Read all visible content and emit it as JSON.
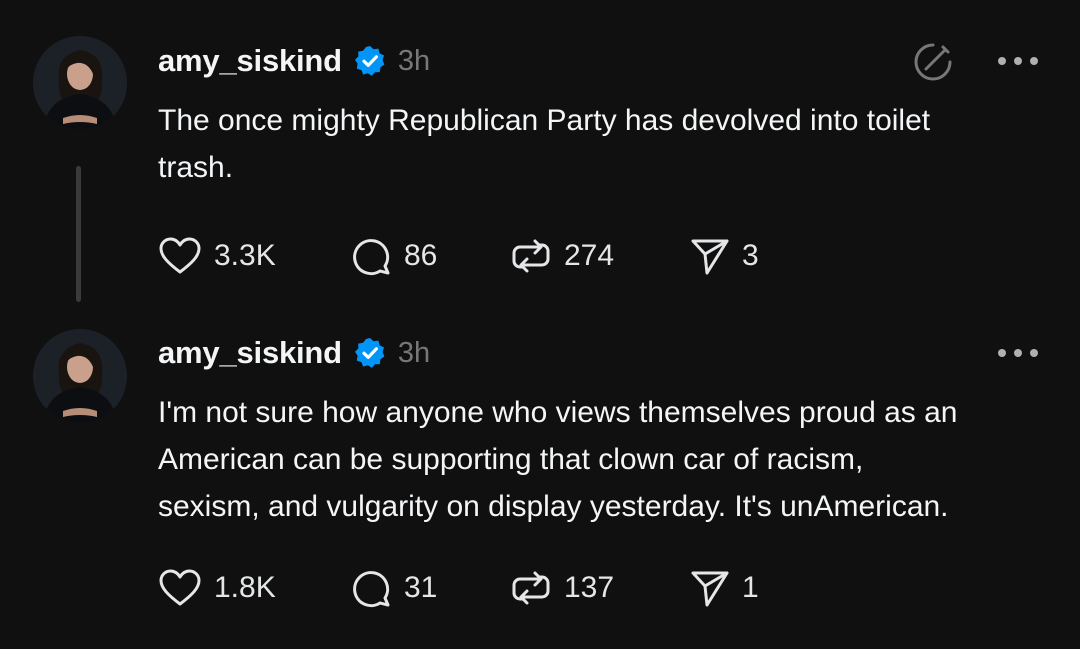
{
  "posts": [
    {
      "username": "amy_siskind",
      "verified": true,
      "time": "3h",
      "text": "The once mighty Republican Party has devolved into toilet\ntrash.",
      "likes": "3.3K",
      "replies": "86",
      "reposts": "274",
      "shares": "3"
    },
    {
      "username": "amy_siskind",
      "verified": true,
      "time": "3h",
      "text": "I'm not sure how anyone who views themselves proud as an\nAmerican can be supporting that clown car of racism,\nsexism, and vulgarity on display yesterday. It's unAmerican.",
      "likes": "1.8K",
      "replies": "31",
      "reposts": "137",
      "shares": "1"
    }
  ],
  "icons": {
    "verified": "verified-badge-icon",
    "edit": "edit-icon",
    "more": "more-options-icon",
    "like": "heart-icon",
    "reply": "comment-icon",
    "repost": "repost-icon",
    "share": "send-icon"
  },
  "colors": {
    "background": "#101010",
    "text": "#f3f5f7",
    "muted": "#777777",
    "verified": "#0095f6"
  }
}
